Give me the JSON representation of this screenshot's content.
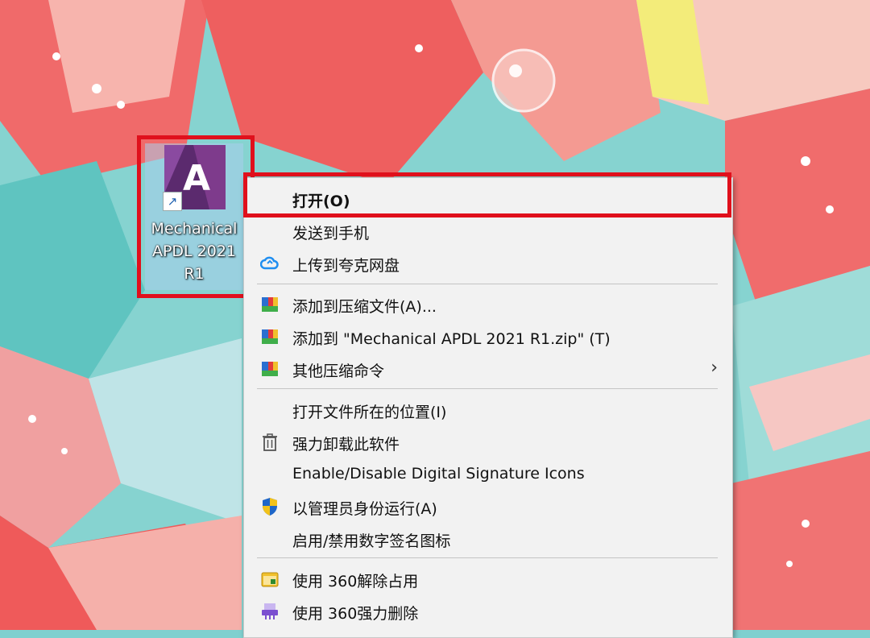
{
  "desktop": {
    "icon": {
      "name": "Mechanical APDL 2021 R1",
      "glyph_letter": "A",
      "shortcut_arrow": "↗"
    }
  },
  "context_menu": {
    "items": [
      {
        "label": "打开(O)",
        "icon": "none"
      },
      {
        "label": "发送到手机",
        "icon": "none"
      },
      {
        "label": "上传到夸克网盘",
        "icon": "cloud-icon"
      },
      {
        "label": "添加到压缩文件(A)...",
        "icon": "archive-icon"
      },
      {
        "label": "添加到 \"Mechanical APDL 2021 R1.zip\" (T)",
        "icon": "archive-icon"
      },
      {
        "label": "其他压缩命令",
        "icon": "archive-icon",
        "submenu_arrow": "›"
      },
      {
        "label": "打开文件所在的位置(I)",
        "icon": "none"
      },
      {
        "label": "强力卸载此软件",
        "icon": "trash-icon"
      },
      {
        "label": "Enable/Disable Digital Signature Icons",
        "icon": "none"
      },
      {
        "label": "以管理员身份运行(A)",
        "icon": "shield-icon"
      },
      {
        "label": "启用/禁用数字签名图标",
        "icon": "none"
      },
      {
        "label": "使用 360解除占用",
        "icon": "unlock-icon"
      },
      {
        "label": "使用 360强力删除",
        "icon": "shredder-icon"
      }
    ]
  },
  "colors": {
    "highlight": "#e0101c",
    "menu_bg": "#f2f2f2"
  }
}
